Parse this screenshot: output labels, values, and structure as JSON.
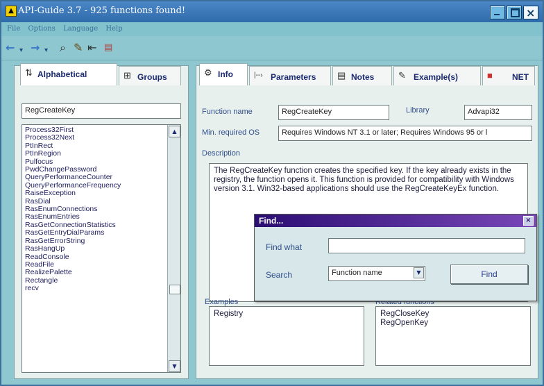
{
  "window": {
    "title": "API-Guide 3.7 - 925 functions found!"
  },
  "menu": [
    "File",
    "Options",
    "Language",
    "Help"
  ],
  "left_tabs": [
    {
      "label": "Alphabetical",
      "icon": "sort-icon"
    },
    {
      "label": "Groups",
      "icon": "groups-icon"
    }
  ],
  "search": {
    "value": "RegCreateKey"
  },
  "function_list": [
    "Process32First",
    "Process32Next",
    "PtInRect",
    "PtInRegion",
    "Pulfocus",
    "PwdChangePassword",
    "QueryPerformanceCounter",
    "QueryPerformanceFrequency",
    "RaiseException",
    "RasDial",
    "RasEnumConnections",
    "RasEnumEntries",
    "RasGetConnectionStatistics",
    "RasGetEntryDialParams",
    "RasGetErrorString",
    "RasHangUp",
    "ReadConsole",
    "ReadFile",
    "RealizePalette",
    "Rectangle",
    "recv"
  ],
  "right_tabs": [
    {
      "label": "Info",
      "icon": "info-icon"
    },
    {
      "label": "Parameters",
      "icon": "parameters-icon"
    },
    {
      "label": "Notes",
      "icon": "notes-icon"
    },
    {
      "label": "Example(s)",
      "icon": "examples-icon"
    },
    {
      "label": "NET",
      "icon": "net-icon"
    }
  ],
  "info": {
    "function_name_label": "Function name",
    "function_name": "RegCreateKey",
    "library_label": "Library",
    "library": "Advapi32",
    "min_os_label": "Min. required OS",
    "min_os": "Requires Windows NT 3.1 or later; Requires Windows 95 or l",
    "description_label": "Description",
    "description": "The RegCreateKey function creates the specified key. If the key already exists in the registry, the function opens it. This function is provided for compatibility with Windows version 3.1. Win32-based applications should use the RegCreateKeyEx function.",
    "examples_label": "Examples",
    "examples": [
      "Registry"
    ],
    "related_label": "Related functions",
    "related": [
      "RegCloseKey",
      "RegOpenKey"
    ]
  },
  "find_dialog": {
    "title": "Find...",
    "find_what_label": "Find what",
    "find_what_value": "",
    "search_label": "Search",
    "search_option": "Function name",
    "find_button": "Find"
  }
}
